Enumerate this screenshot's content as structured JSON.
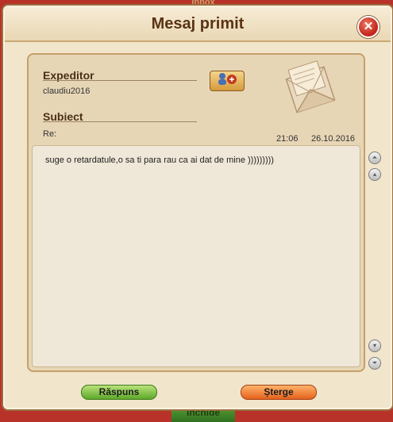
{
  "background_window": {
    "title_fragment": "Inbox",
    "bottom_button": "Închide"
  },
  "dialog": {
    "title": "Mesaj primit",
    "close_glyph": "✕",
    "sender_label": "Expeditor",
    "sender_value": "claudiu2016",
    "subject_label": "Subiect",
    "subject_value": "Re:",
    "time": "21:06",
    "date": "26.10.2016",
    "message_body": "suge o retardatule,o sa ti para rau ca ai dat de mine )))))))))",
    "reply_button": "Răspuns",
    "delete_button": "Șterge"
  },
  "icons": {
    "profile": "user-profile-icon",
    "envelope": "envelope-letter-icon",
    "scroll_top": "scroll-top-icon",
    "scroll_up": "scroll-up-icon",
    "scroll_down": "scroll-down-icon",
    "scroll_bottom": "scroll-bottom-icon"
  },
  "colors": {
    "accent_green": "#5ea82a",
    "accent_orange": "#e4621d",
    "close_red": "#c3261b"
  }
}
